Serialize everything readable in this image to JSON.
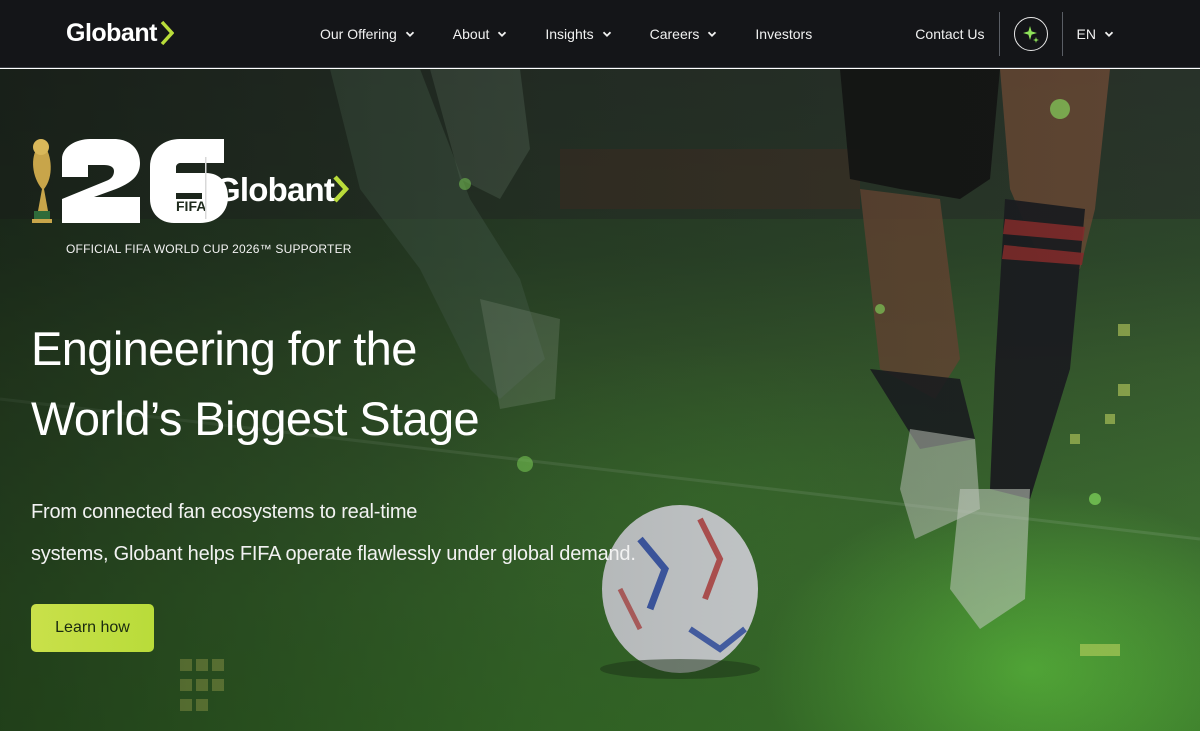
{
  "brand": {
    "logo_text": "Globant",
    "accent": "#b9dc3a"
  },
  "nav": {
    "items": [
      {
        "label": "Our Offering",
        "has_caret": true
      },
      {
        "label": "About",
        "has_caret": true
      },
      {
        "label": "Insights",
        "has_caret": true
      },
      {
        "label": "Careers",
        "has_caret": true
      },
      {
        "label": "Investors",
        "has_caret": false
      }
    ],
    "contact_label": "Contact Us",
    "ai_icon": "sparkle-icon",
    "language": "EN"
  },
  "hero": {
    "lockup": {
      "number": "26",
      "fifa": "FIFA",
      "partner": "Globant"
    },
    "supporter_text": "OFFICIAL FIFA WORLD CUP 2026™ SUPPORTER",
    "headline_line1": "Engineering for the",
    "headline_line2": "World’s Biggest Stage",
    "sub_line1": "From connected fan ecosystems to real-time",
    "sub_line2": "systems, Globant helps FIFA operate flawlessly under global demand.",
    "cta_label": "Learn how"
  }
}
